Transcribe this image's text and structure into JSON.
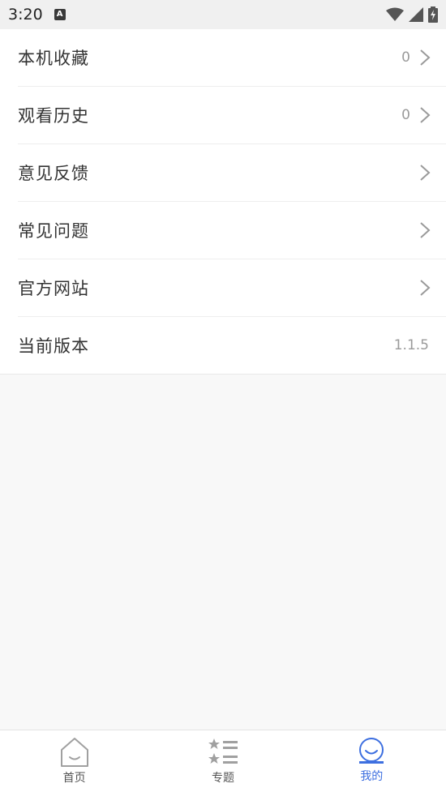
{
  "status_bar": {
    "time": "3:20",
    "notification_letter": "A"
  },
  "menu": {
    "items": [
      {
        "title": "本机收藏",
        "value": "0"
      },
      {
        "title": "观看历史",
        "value": "0"
      },
      {
        "title": "意见反馈",
        "value": ""
      },
      {
        "title": "常见问题",
        "value": ""
      },
      {
        "title": "官方网站",
        "value": ""
      },
      {
        "title": "当前版本",
        "value": "1.1.5"
      }
    ]
  },
  "tabbar": {
    "tabs": [
      {
        "label": "首页",
        "icon": "home-icon"
      },
      {
        "label": "专题",
        "icon": "star-list-icon"
      },
      {
        "label": "我的",
        "icon": "smile-icon"
      }
    ],
    "active_index": 2,
    "active_color": "#3d6fe0",
    "inactive_color": "#a0a0a0"
  }
}
